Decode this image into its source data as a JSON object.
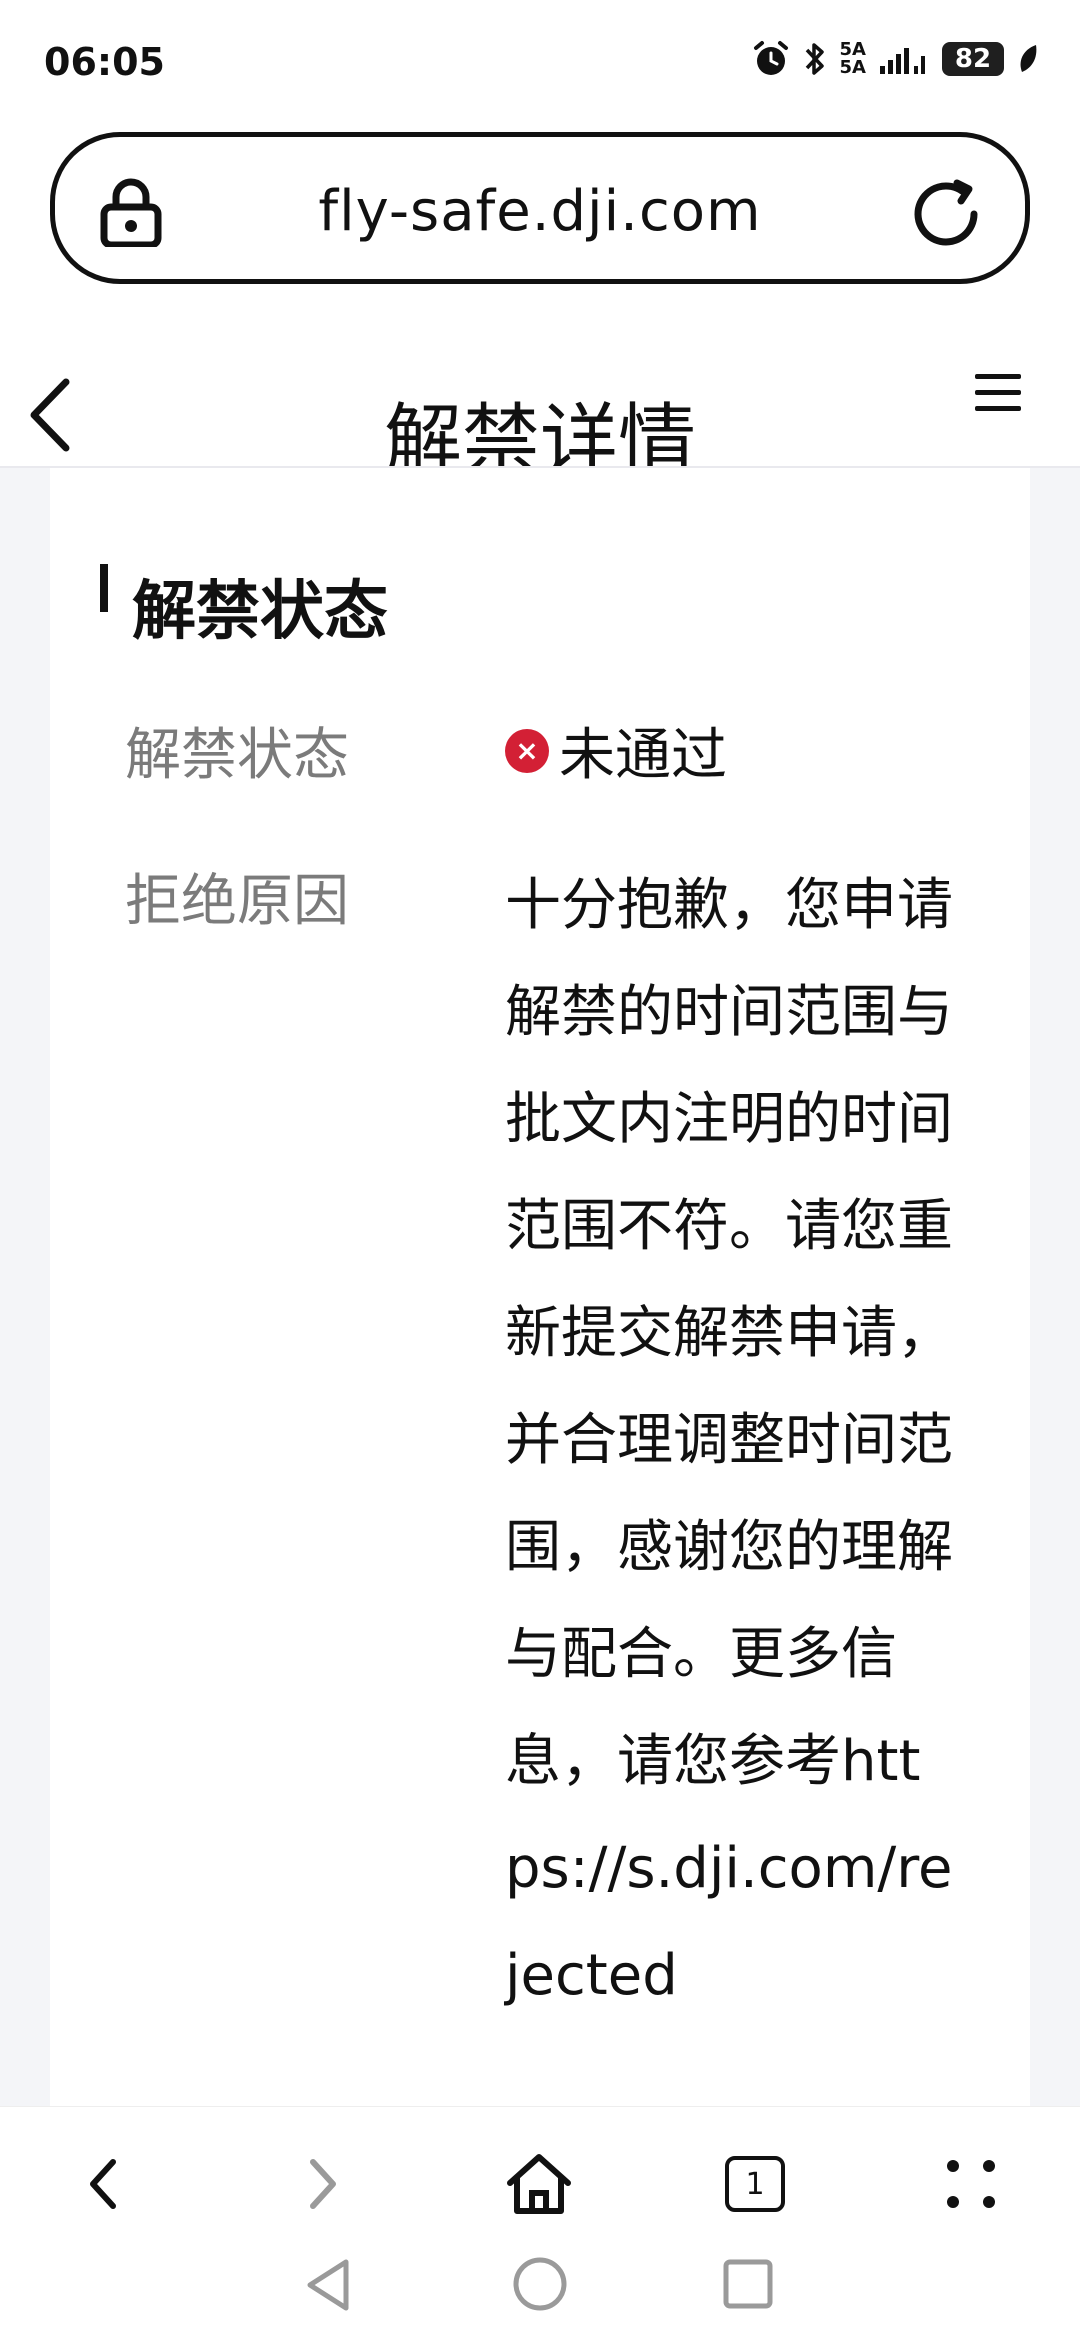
{
  "status_bar": {
    "time": "06:05",
    "network_top": "5A",
    "network_bottom": "5A",
    "battery": "82",
    "icons": [
      "alarm-icon",
      "bluetooth-icon",
      "signal-icon",
      "battery-icon",
      "leaf-icon"
    ]
  },
  "address_bar": {
    "url": "fly-safe.dji.com",
    "icons": [
      "lock-icon",
      "reload-icon"
    ]
  },
  "header": {
    "title": "解禁详情",
    "icons": [
      "back-chevron-icon",
      "menu-icon"
    ]
  },
  "section": {
    "title": "解禁状态",
    "rows": [
      {
        "label": "解禁状态",
        "value": "未通过",
        "status_color": "#d32035"
      },
      {
        "label": "拒绝原因",
        "value": "十分抱歉，您申请解禁的时间范围与批文内注明的时间范围不符。请您重新提交解禁申请，并合理调整时间范围，感谢您的理解与配合。更多信息，请您参考https://s.dji.com/rejected"
      }
    ]
  },
  "bottom_toolbar": {
    "tab_count": "1",
    "icons": [
      "back-icon",
      "forward-icon",
      "home-icon",
      "tabs-icon",
      "more-icon"
    ]
  },
  "system_nav": {
    "icons": [
      "nav-back-icon",
      "nav-home-icon",
      "nav-recent-icon"
    ]
  }
}
